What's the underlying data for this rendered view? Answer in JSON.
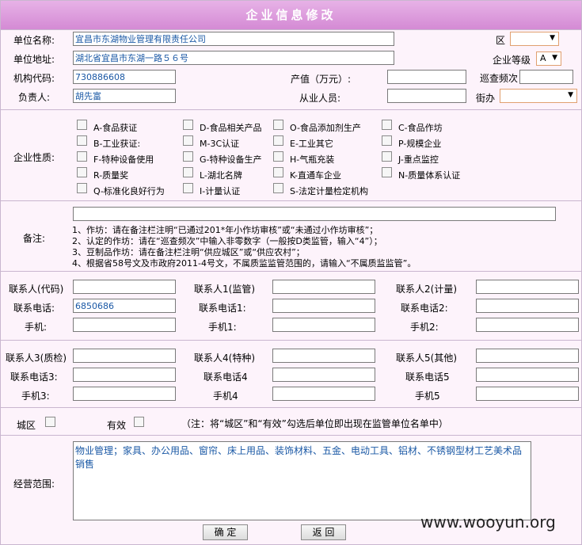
{
  "title": "企业信息修改",
  "unit_name_label": "单位名称:",
  "unit_name_value": "宜昌市东湖物业管理有限责任公司",
  "district_label": "区",
  "unit_address_label": "单位地址:",
  "unit_address_value": "湖北省宜昌市东湖一路５６号",
  "grade_label": "企业等级",
  "grade_value": "A",
  "org_code_label": "机构代码:",
  "org_code_value": "730886608",
  "output_label": "产值（万元）:",
  "patrol_label": "巡查频次",
  "leader_label": "负责人:",
  "leader_value": "胡先富",
  "staff_label": "从业人员:",
  "street_label": "街办",
  "nature_label": "企业性质:",
  "natures": [
    "A-食品获证",
    "D-食品相关产品",
    "O-食品添加剂生产",
    "C-食品作坊",
    "B-工业获证:",
    "M-3C认证",
    "E-工业其它",
    "P-规模企业",
    "F-特种设备使用",
    "G-特种设备生产",
    "H-气瓶充装",
    "J-重点监控",
    "R-质量奖",
    "L-湖北名牌",
    "K-直通车企业",
    "N-质量体系认证",
    "Q-标准化良好行为",
    "I-计量认证",
    "S-法定计量检定机构"
  ],
  "notes_label": "备注:",
  "notes": [
    "1、作坊：请在备注栏注明“已通过201*年小作坊审核”或“未通过小作坊审核”；",
    "2、认定的作坊：请在“巡查频次”中输入非零数字（一般按D类监管，输入“4”）；",
    "3、豆制品作坊：请在备注栏注明“供应城区”或“供应农村”；",
    "4、根据省58号文及市政府2011-4号文，不属质监监管范围的，请输入“不属质监监管”。"
  ],
  "contacts": {
    "c0": "联系人(代码)",
    "c1": "联系人1(监管)",
    "c2": "联系人2(计量)",
    "p0": "联系电话:",
    "p1": "联系电话1:",
    "p2": "联系电话2:",
    "m0": "手机:",
    "m1": "手机1:",
    "m2": "手机2:",
    "phone_value": "6850686",
    "c3": "联系人3(质检)",
    "c4": "联系人4(特种)",
    "c5": "联系人5(其他)",
    "p3": "联系电话3:",
    "p4": "联系电话4",
    "p5": "联系电话5",
    "m3": "手机3:",
    "m4": "手机4",
    "m5": "手机5"
  },
  "city_label": "城区",
  "valid_label": "有效",
  "city_note": "（注：将“城区”和“有效”勾选后单位即出现在监管单位名单中）",
  "scope_label": "经营范围:",
  "scope_value": "物业管理；家具、办公用品、窗帘、床上用品、装饰材料、五金、电动工具、铝材、不锈钢型材工艺美术品销售",
  "ok_label": "确 定",
  "back_label": "返 回",
  "watermark": "www.wooyun.org"
}
